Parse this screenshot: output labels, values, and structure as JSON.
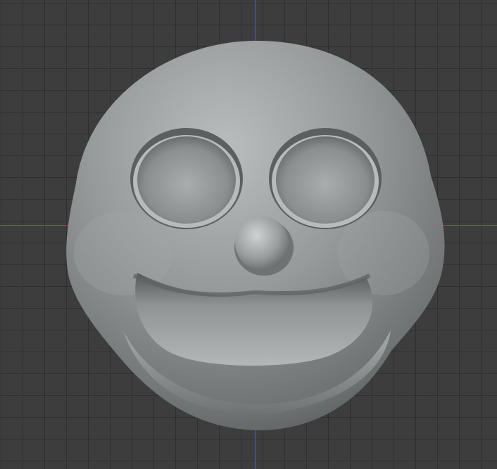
{
  "viewport": {
    "background": "#3d3d3d",
    "grid_color": "#2f2f2f",
    "axis_x_color": "#b0414a",
    "axis_y_color": "#3f62b8"
  },
  "model": {
    "name": "face-sculpt",
    "base_color": "#8e9293",
    "highlight_color": "#c9cccc",
    "shadow_color": "#505454"
  }
}
